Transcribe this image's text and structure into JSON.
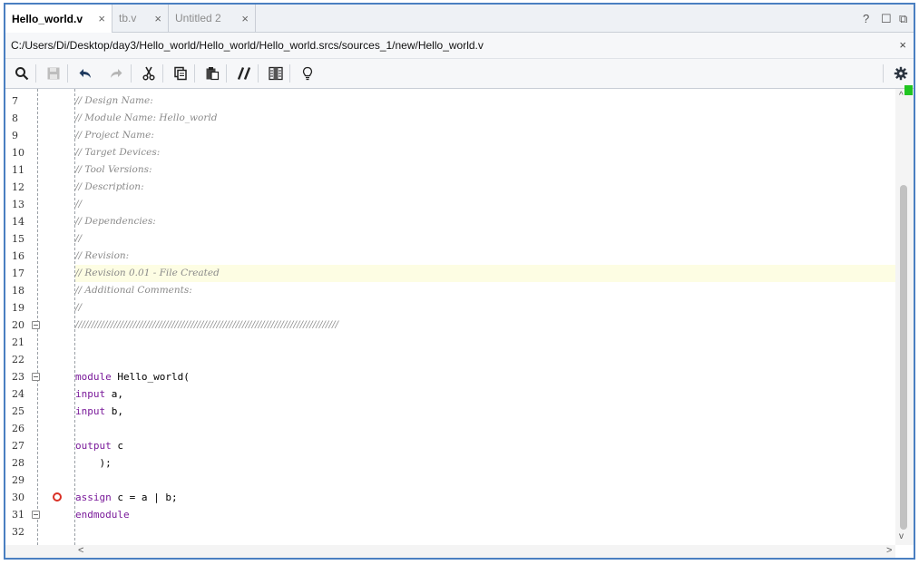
{
  "tabs": [
    {
      "label": "Hello_world.v",
      "active": true
    },
    {
      "label": "tb.v",
      "active": false
    },
    {
      "label": "Untitled 2",
      "active": false
    }
  ],
  "tab_close_glyph": "×",
  "window_controls": {
    "help": "?",
    "maximize": "☐",
    "float": "⧉"
  },
  "file_path": "C:/Users/Di/Desktop/day3/Hello_world/Hello_world/Hello_world.srcs/sources_1/new/Hello_world.v",
  "path_close": "×",
  "toolbar_icons": [
    "search-icon",
    "save-icon",
    "undo-icon",
    "redo-icon",
    "cut-icon",
    "copy-icon",
    "paste-icon",
    "comment-toggle-icon",
    "column-select-icon",
    "lightbulb-icon",
    "settings-icon"
  ],
  "editor": {
    "lines": [
      {
        "num": "7",
        "text": "// Design Name:",
        "type": "comment"
      },
      {
        "num": "8",
        "text": "// Module Name: Hello_world",
        "type": "comment"
      },
      {
        "num": "9",
        "text": "// Project Name:",
        "type": "comment"
      },
      {
        "num": "10",
        "text": "// Target Devices:",
        "type": "comment"
      },
      {
        "num": "11",
        "text": "// Tool Versions:",
        "type": "comment"
      },
      {
        "num": "12",
        "text": "// Description:",
        "type": "comment"
      },
      {
        "num": "13",
        "text": "//",
        "type": "comment"
      },
      {
        "num": "14",
        "text": "// Dependencies:",
        "type": "comment"
      },
      {
        "num": "15",
        "text": "//",
        "type": "comment"
      },
      {
        "num": "16",
        "text": "// Revision:",
        "type": "comment"
      },
      {
        "num": "17",
        "text": "// Revision 0.01 - File Created",
        "type": "comment"
      },
      {
        "num": "18",
        "text": "// Additional Comments:",
        "type": "comment"
      },
      {
        "num": "19",
        "text": "//",
        "type": "comment"
      },
      {
        "num": "20",
        "text": "//////////////////////////////////////////////////////////////////////////////////",
        "type": "comment"
      },
      {
        "num": "21",
        "text": "",
        "type": "code"
      },
      {
        "num": "22",
        "text": "",
        "type": "code"
      },
      {
        "num": "23",
        "kw": "module",
        "rest": " Hello_world(",
        "type": "code"
      },
      {
        "num": "24",
        "kw": "input",
        "rest": " a,",
        "type": "code"
      },
      {
        "num": "25",
        "kw": "input",
        "rest": " b,",
        "type": "code"
      },
      {
        "num": "26",
        "text": "",
        "type": "code"
      },
      {
        "num": "27",
        "kw": "output",
        "rest": " c",
        "type": "code"
      },
      {
        "num": "28",
        "text": "    );",
        "type": "code"
      },
      {
        "num": "29",
        "text": "",
        "type": "code"
      },
      {
        "num": "30",
        "kw": "assign",
        "rest": " c = a | b;",
        "type": "code"
      },
      {
        "num": "31",
        "kw": "endmodule",
        "rest": "",
        "type": "code"
      },
      {
        "num": "32",
        "text": "",
        "type": "code"
      }
    ],
    "highlighted_line": "17",
    "fold_markers": [
      "20",
      "23",
      "31"
    ],
    "breakpoint_line": "30"
  },
  "colors": {
    "accent": "#4a7fc1",
    "keyword": "#7a1a9a",
    "comment": "#8a8a8a",
    "highlight": "#fdfde3",
    "breakpoint": "#d93025",
    "marker": "#21c521"
  }
}
